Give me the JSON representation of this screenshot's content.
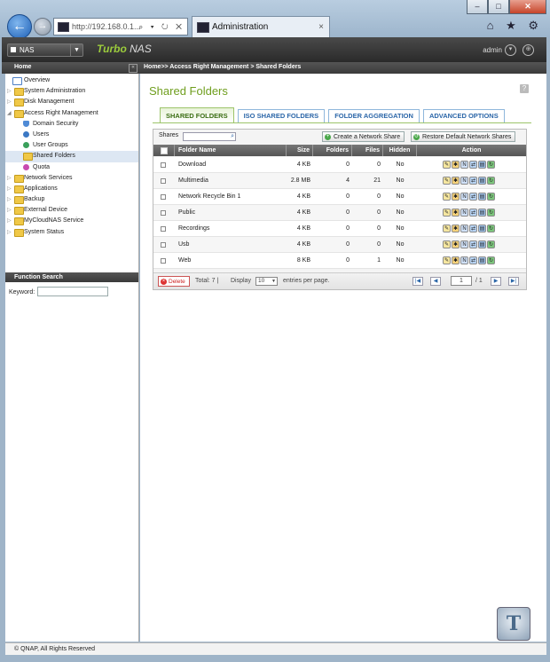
{
  "browser": {
    "address": "http://192.168.0.1...",
    "address_tools": "⌕ ▾ ↻ ✕",
    "tab_title": "Administration",
    "tab_close": "×",
    "win_min": "–",
    "win_max": "□",
    "win_close": "✕",
    "right_tools": "⌂ ★ ⚙"
  },
  "header": {
    "nas_button": "NAS",
    "brand_prefix": "Turbo ",
    "brand_suffix": "NAS",
    "user": "admin"
  },
  "subbar": {
    "home": "Home",
    "breadcrumb": "Home>> Access Right Management > Shared Folders"
  },
  "sidebar": {
    "items": [
      {
        "label": "Overview",
        "icon": "overview-icon"
      },
      {
        "label": "System Administration",
        "icon": "folder-icon"
      },
      {
        "label": "Disk Management",
        "icon": "folder-icon"
      },
      {
        "label": "Access Right Management",
        "icon": "folder-icon"
      },
      {
        "label": "Domain Security",
        "icon": "shield-icon"
      },
      {
        "label": "Users",
        "icon": "user-icon"
      },
      {
        "label": "User Groups",
        "icon": "group-icon"
      },
      {
        "label": "Shared Folders",
        "icon": "shared-folder-icon"
      },
      {
        "label": "Quota",
        "icon": "quota-icon"
      },
      {
        "label": "Network Services",
        "icon": "folder-icon"
      },
      {
        "label": "Applications",
        "icon": "folder-icon"
      },
      {
        "label": "Backup",
        "icon": "folder-icon"
      },
      {
        "label": "External Device",
        "icon": "folder-icon"
      },
      {
        "label": "MyCloudNAS Service",
        "icon": "folder-icon"
      },
      {
        "label": "System Status",
        "icon": "folder-icon"
      }
    ],
    "function_search_title": "Function Search",
    "keyword_label": "Keyword:"
  },
  "main": {
    "title": "Shared Folders",
    "help": "?",
    "tabs": [
      "SHARED FOLDERS",
      "ISO SHARED FOLDERS",
      "FOLDER AGGREGATION",
      "ADVANCED OPTIONS"
    ],
    "shares_label": "Shares",
    "create_button": "Create a Network Share",
    "restore_button": "Restore Default Network Shares",
    "columns": [
      "Folder Name",
      "Size",
      "Folders",
      "Files",
      "Hidden",
      "Action"
    ],
    "rows": [
      {
        "name": "Download",
        "size": "4 KB",
        "folders": "0",
        "files": "0",
        "hidden": "No"
      },
      {
        "name": "Multimedia",
        "size": "2.8 MB",
        "folders": "4",
        "files": "21",
        "hidden": "No"
      },
      {
        "name": "Network Recycle Bin 1",
        "size": "4 KB",
        "folders": "0",
        "files": "0",
        "hidden": "No"
      },
      {
        "name": "Public",
        "size": "4 KB",
        "folders": "0",
        "files": "0",
        "hidden": "No"
      },
      {
        "name": "Recordings",
        "size": "4 KB",
        "folders": "0",
        "files": "0",
        "hidden": "No"
      },
      {
        "name": "Usb",
        "size": "4 KB",
        "folders": "0",
        "files": "0",
        "hidden": "No"
      },
      {
        "name": "Web",
        "size": "8 KB",
        "folders": "0",
        "files": "1",
        "hidden": "No"
      }
    ],
    "pager": {
      "delete": "Delete",
      "total": "Total: 7  |",
      "display": "Display",
      "per_page_value": "10",
      "entries_text": "entries per page.",
      "page": "1",
      "of_pages": "/ 1"
    }
  },
  "footer": "© QNAP, All Rights Reserved",
  "colors": {
    "accent": "#6f9e1e",
    "tab_blue": "#2b66a8"
  }
}
